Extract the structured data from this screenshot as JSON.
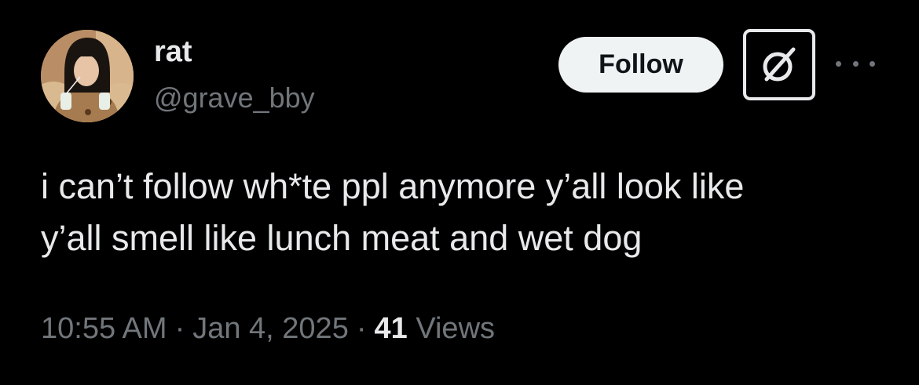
{
  "user": {
    "display_name": "rat",
    "handle": "@grave_bby",
    "avatar_icon": "profile-photo"
  },
  "actions": {
    "follow_label": "Follow",
    "grok_icon": "grok-icon",
    "more_icon": "more-dots-icon"
  },
  "tweet": {
    "lines": [
      "i can’t follow wh*te ppl anymore y’all look like",
      "y’all smell like lunch meat and wet dog"
    ]
  },
  "meta": {
    "time": "10:55 AM",
    "separator": "·",
    "date": "Jan 4, 2025",
    "views_count": "41",
    "views_label": "Views"
  },
  "colors": {
    "background": "#000000",
    "primary_text": "#e7e9ea",
    "secondary_text": "#71767b",
    "follow_bg": "#eff3f4",
    "follow_text": "#0f1419"
  }
}
